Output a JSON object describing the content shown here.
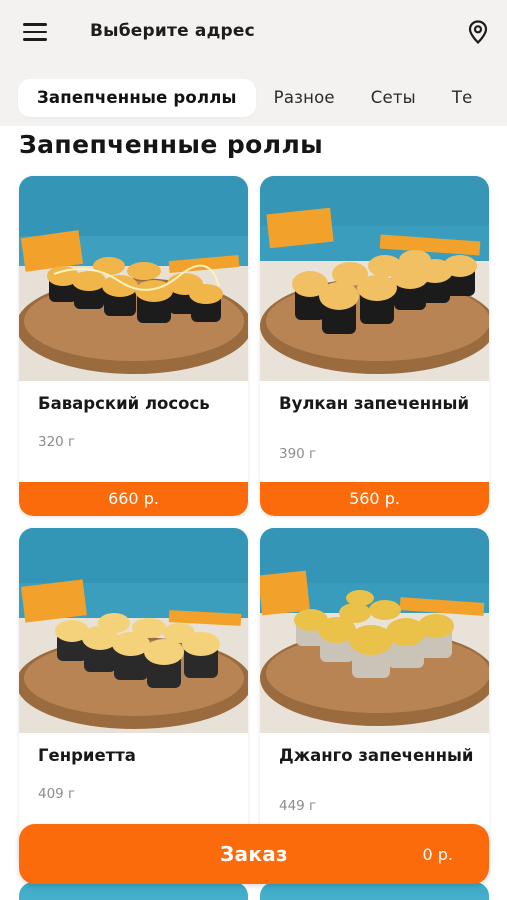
{
  "header": {
    "address_label": "Выберите адрес",
    "menu_icon": "hamburger-menu-icon",
    "location_icon": "map-pin-icon"
  },
  "tabs": [
    {
      "label": "Запепченные роллы",
      "active": true
    },
    {
      "label": "Разное",
      "active": false
    },
    {
      "label": "Сеты",
      "active": false
    },
    {
      "label": "Те",
      "active": false
    }
  ],
  "section": {
    "title": "Запепченные роллы"
  },
  "products": [
    {
      "name": "Баварский лосось",
      "weight": "320 г",
      "price": "660 р."
    },
    {
      "name": "Вулкан запеченный",
      "weight": "390 г",
      "price": "560 р."
    },
    {
      "name": "Генриетта",
      "weight": "409 г",
      "price": ""
    },
    {
      "name": "Джанго запеченный",
      "weight": "449 г",
      "price": ""
    }
  ],
  "order": {
    "label": "Заказ",
    "sum": "0 р."
  },
  "colors": {
    "accent": "#fb6a0b",
    "background": "#f3f2f0",
    "card": "#ffffff"
  }
}
